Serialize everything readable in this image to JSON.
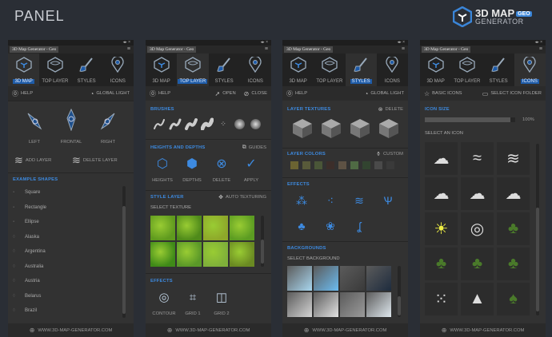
{
  "page_title": "PANEL",
  "logo": {
    "line1": "3D MAP",
    "badge": "GEO",
    "line2": "GENERATOR"
  },
  "panel_common": {
    "window_controls": "◂▸ ×",
    "tab_title": "3D Map Generator - Geo",
    "menu_icon": "≡",
    "tabs": [
      "3D MAP",
      "TOP LAYER",
      "STYLES",
      "ICONS"
    ],
    "footer": "WWW.3D-MAP-GENERATOR.COM"
  },
  "panel1": {
    "help": "HELP",
    "global_light": "GLOBAL LIGHT",
    "views": [
      "LEFT",
      "FRONTAL",
      "RIGHT"
    ],
    "add_layer": "ADD LAYER",
    "delete_layer": "DELETE LAYER",
    "shapes_header": "EXAMPLE SHAPES",
    "shapes": [
      "Square",
      "Rectangle",
      "Ellipse",
      "Alaska",
      "Argentina",
      "Australia",
      "Austria",
      "Belarus",
      "Brazil"
    ]
  },
  "panel2": {
    "help": "HELP",
    "open": "OPEN",
    "close": "CLOSE",
    "brushes_header": "BRUSHES",
    "heights_header": "HEIGHTS AND DEPTHS",
    "guides": "GUIDES",
    "height_tools": [
      "HEIGHTS",
      "DEPTHS",
      "DELETE",
      "APPLY"
    ],
    "style_header": "STYLE LAYER",
    "auto_texturing": "AUTO TEXTURING",
    "select_texture": "SELECT TEXTURE",
    "textures": [
      "#5f9a1e",
      "#4f8a1a",
      "#8ea82a",
      "#5c9c22",
      "#3f8a18",
      "#5a9828",
      "#7fb03a",
      "#6a8a22"
    ],
    "effects_header": "EFFECTS",
    "effects": [
      "CONTOUR",
      "GRID 1",
      "GRID 2"
    ]
  },
  "panel3": {
    "help": "HELP",
    "global_light": "GLOBAL LIGHT",
    "textures_header": "LAYER TEXTURES",
    "delete": "DELETE",
    "colors_header": "LAYER COLORS",
    "custom": "CUSTOM",
    "colors": [
      "#6b6332",
      "#585a3a",
      "#4a5638",
      "#3c2e2a",
      "#5e5244",
      "#4f6a44",
      "#324430",
      "#4a4a4a",
      "#3a3a3a"
    ],
    "effects_header": "EFFECTS",
    "backgrounds_header": "BACKGROUNDS",
    "select_background": "SELECT BACKGROUND",
    "backgrounds": [
      "#a8d6ee",
      "#6cbcf0",
      "#3a3a3a",
      "#1e2c3e",
      "#d4d4d4",
      "#e2e2e2",
      "#9a9a9a",
      "#dfe8ee"
    ]
  },
  "panel4": {
    "basic_icons": "BASIC ICONS",
    "select_folder": "SELECT ICON FOLDER",
    "size_header": "ICON SIZE",
    "size_value": "100%",
    "size_fraction": 0.95,
    "select_icon": "SELECT AN ICON",
    "icons": [
      "cloud-cluster",
      "wind-cloud",
      "wind-streak",
      "snow-cloud",
      "storm-cloud",
      "night-cloud",
      "sun",
      "hurricane",
      "pine-forest",
      "forest",
      "trees",
      "forest-dense",
      "rocks",
      "mountain",
      "pine-tree"
    ]
  },
  "colors": {
    "accent": "#3d8ae0",
    "panel": "#323232",
    "background": "#2a2e35"
  }
}
